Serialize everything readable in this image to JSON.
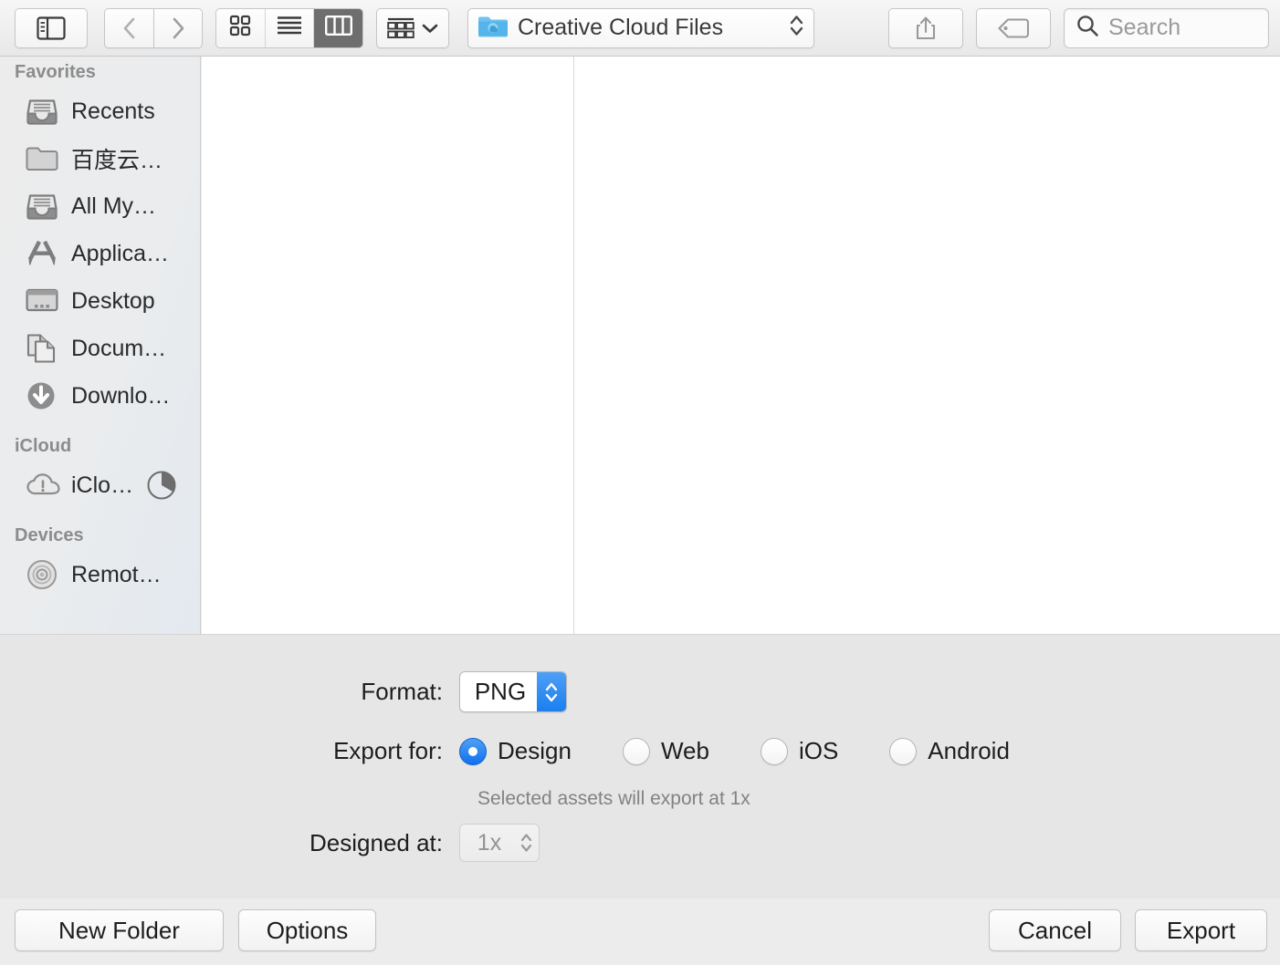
{
  "toolbar": {
    "sidebar_toggle": "sidebar-toggle",
    "back": "back",
    "forward": "forward",
    "view_modes": [
      {
        "name": "icon-view",
        "selected": false
      },
      {
        "name": "list-view",
        "selected": false
      },
      {
        "name": "column-view",
        "selected": true
      }
    ],
    "arrange": "arrange-by",
    "location": "Creative Cloud Files",
    "share": "share",
    "tags": "tags",
    "search_placeholder": "Search"
  },
  "sidebar": {
    "sections": [
      {
        "header": "Favorites",
        "items": [
          {
            "label": "Recents",
            "icon": "recents-icon"
          },
          {
            "label": "百度云…",
            "icon": "folder-icon"
          },
          {
            "label": "All My…",
            "icon": "all-my-files-icon"
          },
          {
            "label": "Applica…",
            "icon": "applications-icon"
          },
          {
            "label": "Desktop",
            "icon": "desktop-icon"
          },
          {
            "label": "Docum…",
            "icon": "documents-icon"
          },
          {
            "label": "Downlo…",
            "icon": "downloads-icon"
          }
        ]
      },
      {
        "header": "iCloud",
        "items": [
          {
            "label": "iClo…",
            "icon": "icloud-alert-icon",
            "badge": "storage-pie"
          }
        ]
      },
      {
        "header": "Devices",
        "items": [
          {
            "label": "Remot…",
            "icon": "remote-disc-icon"
          }
        ]
      }
    ]
  },
  "options": {
    "format_label": "Format:",
    "format_value": "PNG",
    "export_for_label": "Export for:",
    "export_for_options": [
      {
        "label": "Design",
        "selected": true
      },
      {
        "label": "Web",
        "selected": false
      },
      {
        "label": "iOS",
        "selected": false
      },
      {
        "label": "Android",
        "selected": false
      }
    ],
    "hint": "Selected assets will export at 1x",
    "designed_at_label": "Designed at:",
    "designed_at_value": "1x"
  },
  "buttons": {
    "new_folder": "New Folder",
    "options": "Options",
    "cancel": "Cancel",
    "export": "Export"
  },
  "colors": {
    "accent": "#1b7ef0",
    "panel": "#e6e6e6",
    "toolbar": "#ececec"
  }
}
